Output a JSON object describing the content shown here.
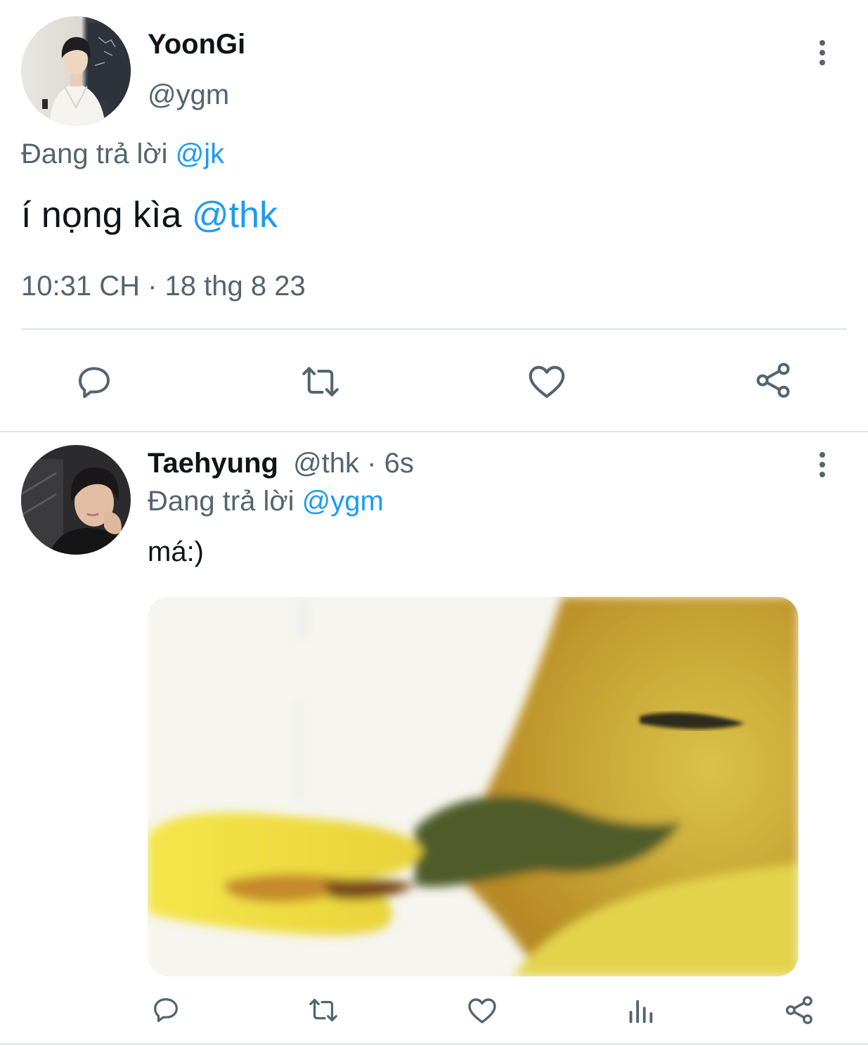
{
  "main_tweet": {
    "display_name": "YoonGi",
    "handle": "@ygm",
    "reply_prefix": "Đang trả lời",
    "reply_to": "@jk",
    "text": "í nọng kìa",
    "mention": "@thk",
    "timestamp": "10:31 CH · 18 thg 8 23",
    "actions": [
      "reply-icon",
      "retweet-icon",
      "like-icon",
      "share-icon"
    ]
  },
  "reply_tweet": {
    "display_name": "Taehyung",
    "handle": "@thk",
    "time_ago": "· 6s",
    "reply_prefix": "Đang trả lời",
    "reply_to": "@ygm",
    "text": "má:)",
    "media": "duck-photo",
    "actions": [
      "reply-icon",
      "retweet-icon",
      "like-icon",
      "analytics-icon",
      "share-icon"
    ]
  },
  "colors": {
    "accent": "#1d9bf0",
    "muted": "#536471",
    "icon": "#536471",
    "divider": "#e1e6ea"
  }
}
